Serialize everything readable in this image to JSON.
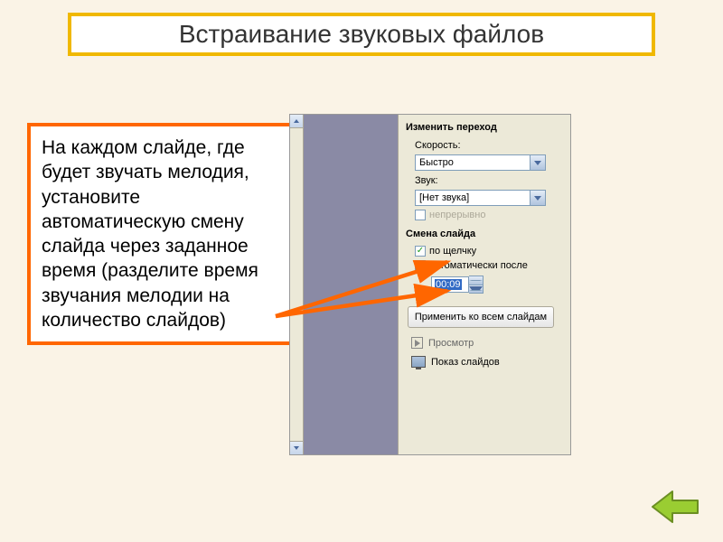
{
  "title": "Встраивание звуковых файлов",
  "instruction": "На каждом слайде, где будет звучать мелодия, установите автоматическую смену слайда через заданное время (разделите время звучания мелодии на количество слайдов)",
  "panel": {
    "section_transition": "Изменить переход",
    "speed_label": "Скорость:",
    "speed_value": "Быстро",
    "sound_label": "Звук:",
    "sound_value": "[Нет звука]",
    "loop_label": "непрерывно",
    "section_advance": "Смена слайда",
    "on_click": "по щелчку",
    "auto_after": "автоматически после",
    "time_value": "00:09",
    "apply_all": "Применить ко всем слайдам",
    "preview": "Просмотр",
    "slideshow": "Показ слайдов"
  },
  "colors": {
    "accent_orange": "#ff6600",
    "accent_yellow": "#f0b800",
    "bg": "#faf3e6",
    "panel_bg": "#ece9d8"
  }
}
